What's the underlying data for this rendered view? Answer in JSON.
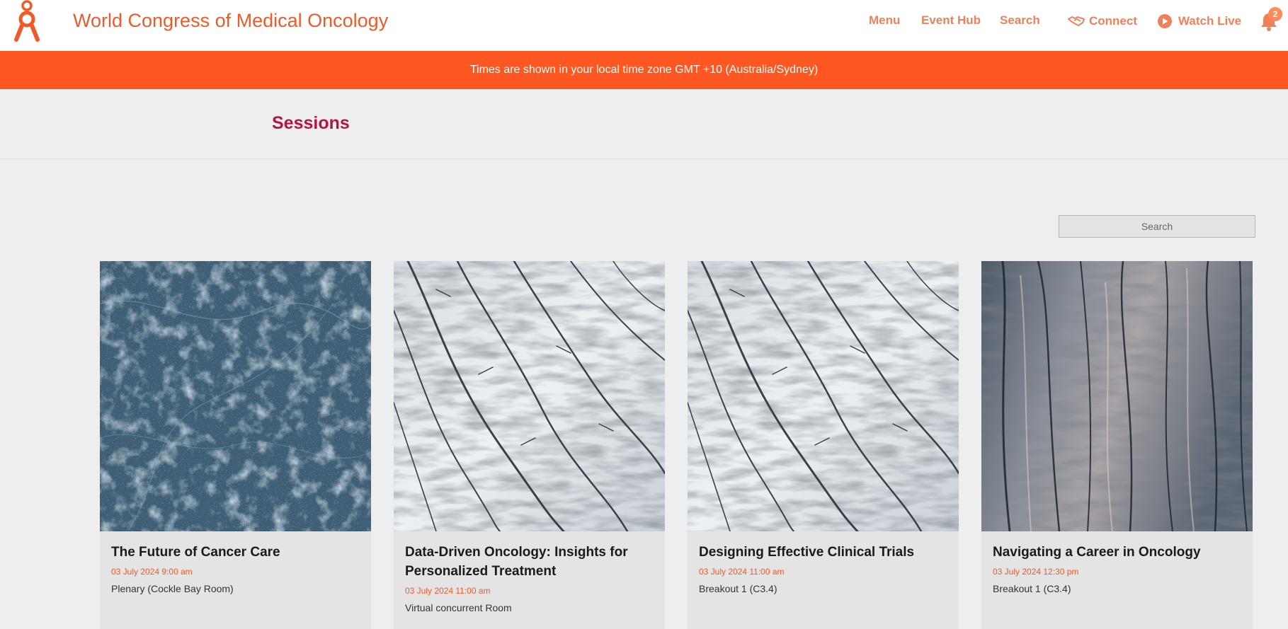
{
  "header": {
    "title": "World Congress of Medical Oncology",
    "nav": {
      "menu": "Menu",
      "event_hub": "Event Hub",
      "search": "Search",
      "connect": "Connect",
      "watch_live": "Watch Live"
    },
    "notification_count": "2",
    "accent_color": "#f05a28"
  },
  "banner": {
    "text": "Times are shown in your local time zone GMT +10 (Australia/Sydney)",
    "color": "#ff5722"
  },
  "page": {
    "title": "Sessions",
    "title_color": "#b0183e"
  },
  "search": {
    "placeholder": "Search"
  },
  "sessions": [
    {
      "title": "The Future of Cancer Care",
      "datetime": "03 July 2024 9:00 am",
      "room": "Plenary (Cockle Bay Room)",
      "image": "dark-blue-ice-texture"
    },
    {
      "title": "Data-Driven Oncology: Insights for Personalized Treatment",
      "datetime": "03 July 2024 11:00 am",
      "room": "Virtual concurrent Room",
      "image": "white-glacier-crevasses"
    },
    {
      "title": "Designing Effective Clinical Trials",
      "datetime": "03 July 2024 11:00 am",
      "room": "Breakout 1 (C3.4)",
      "image": "white-glacier-crevasses"
    },
    {
      "title": "Navigating a Career in Oncology",
      "datetime": "03 July 2024 12:30 pm",
      "room": "Breakout 1 (C3.4)",
      "image": "grey-ridged-glacier"
    }
  ]
}
